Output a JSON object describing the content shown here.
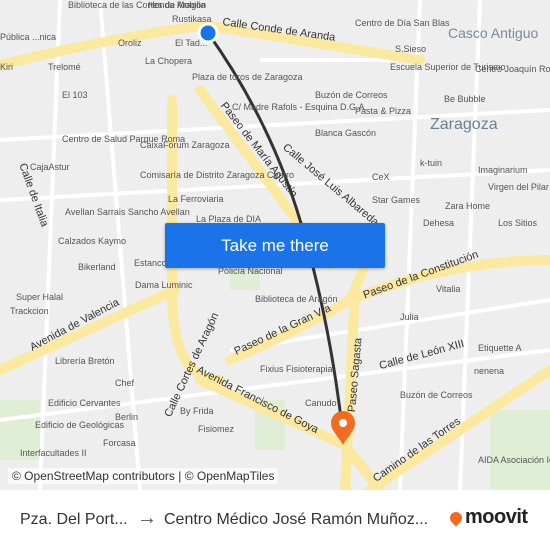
{
  "map": {
    "streets": [
      "Calle Conde de Aranda",
      "Paseo de María Agustín",
      "Calle José Luis Albareda",
      "Paseo de la Constitución",
      "Avenida de Valencia",
      "Paseo de la Gran Vía",
      "Calle Cortes de Aragón",
      "Avenida Francisco de Goya",
      "Paseo Sagasta",
      "Calle de León XIII",
      "Camino de las Torres",
      "Calle de Italia"
    ],
    "areas": [
      "Zaragoza",
      "Casco Antiguo"
    ],
    "pois": [
      "Biblioteca de las Cortes de Aragón",
      "Honda Mobilia",
      "Rustikasa",
      "Pública ...nica",
      "Kiri",
      "Oroliz",
      "El Tad...",
      "Trelomé",
      "La Chopera",
      "Plaza de toros de Zaragoza",
      "El 103",
      "Centro de Día San Blas",
      "S.Sieso",
      "Escuela Superior de Turismo",
      "Centro Joaquín Roncal",
      "Buzón de Correos",
      "Pasta & Pizza",
      "Be Bubble",
      "C/ Madre Rafols - Esquina D.G.A.",
      "Blanca Gascón",
      "Centro de Salud Parque Roma",
      "CajaAstur",
      "CaixaForum Zaragoza",
      "Comisaría de Distrito Zaragoza Centro",
      "La Ferroviaria",
      "La Plaza de DIA",
      "k-tuin",
      "Imaginarium",
      "Virgen del Pilar",
      "CeX",
      "Star Games",
      "Zara Home",
      "Los Sitios",
      "Dehesa",
      "Avellan Sarrais Sancho Avellan",
      "Calzados Kaymo",
      "Bikerland",
      "Estanco",
      "Policía Nacional",
      "Dama Luminic",
      "Super Halal",
      "Trackcion",
      "Vitalia",
      "Julia",
      "Biblioteca de Aragón",
      "Etiquette A",
      "nenena",
      "Librería Bretón",
      "Chef",
      "Fixius Fisioterapia",
      "Edificio Cervantes",
      "Berlin",
      "By Frida",
      "Canudo",
      "Buzón de Correos",
      "Edificio de Geológicas",
      "Forcasa",
      "Fisiomez",
      "Interfacultades II",
      "AIDA Asociación Ictus Aragón"
    ]
  },
  "cta": {
    "label": "Take me there"
  },
  "attribution": "© OpenStreetMap contributors | © OpenMapTiles",
  "footer": {
    "from": "Pza. Del Port...",
    "arrow": "→",
    "to": "Centro Médico José Ramón Muñoz...",
    "brand": "moovit"
  },
  "colors": {
    "button": "#1a73e8",
    "route": "#333333",
    "destination_pin": "#f26b21",
    "origin_dot": "#1a73e8",
    "major_road": "#fbe9a0"
  }
}
